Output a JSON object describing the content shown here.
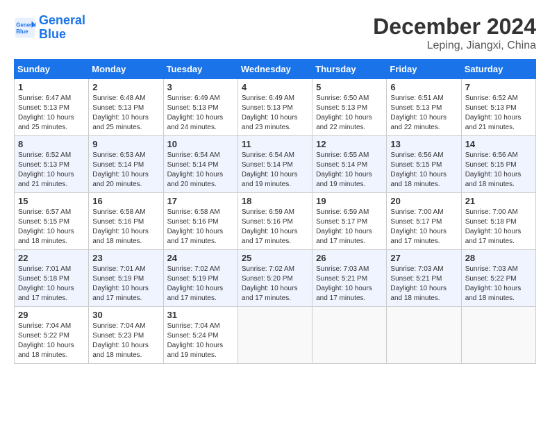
{
  "header": {
    "logo_line1": "General",
    "logo_line2": "Blue",
    "month_title": "December 2024",
    "location": "Leping, Jiangxi, China"
  },
  "days_of_week": [
    "Sunday",
    "Monday",
    "Tuesday",
    "Wednesday",
    "Thursday",
    "Friday",
    "Saturday"
  ],
  "weeks": [
    [
      {
        "day": "1",
        "sunrise": "6:47 AM",
        "sunset": "5:13 PM",
        "daylight": "10 hours and 25 minutes."
      },
      {
        "day": "2",
        "sunrise": "6:48 AM",
        "sunset": "5:13 PM",
        "daylight": "10 hours and 25 minutes."
      },
      {
        "day": "3",
        "sunrise": "6:49 AM",
        "sunset": "5:13 PM",
        "daylight": "10 hours and 24 minutes."
      },
      {
        "day": "4",
        "sunrise": "6:49 AM",
        "sunset": "5:13 PM",
        "daylight": "10 hours and 23 minutes."
      },
      {
        "day": "5",
        "sunrise": "6:50 AM",
        "sunset": "5:13 PM",
        "daylight": "10 hours and 22 minutes."
      },
      {
        "day": "6",
        "sunrise": "6:51 AM",
        "sunset": "5:13 PM",
        "daylight": "10 hours and 22 minutes."
      },
      {
        "day": "7",
        "sunrise": "6:52 AM",
        "sunset": "5:13 PM",
        "daylight": "10 hours and 21 minutes."
      }
    ],
    [
      {
        "day": "8",
        "sunrise": "6:52 AM",
        "sunset": "5:13 PM",
        "daylight": "10 hours and 21 minutes."
      },
      {
        "day": "9",
        "sunrise": "6:53 AM",
        "sunset": "5:14 PM",
        "daylight": "10 hours and 20 minutes."
      },
      {
        "day": "10",
        "sunrise": "6:54 AM",
        "sunset": "5:14 PM",
        "daylight": "10 hours and 20 minutes."
      },
      {
        "day": "11",
        "sunrise": "6:54 AM",
        "sunset": "5:14 PM",
        "daylight": "10 hours and 19 minutes."
      },
      {
        "day": "12",
        "sunrise": "6:55 AM",
        "sunset": "5:14 PM",
        "daylight": "10 hours and 19 minutes."
      },
      {
        "day": "13",
        "sunrise": "6:56 AM",
        "sunset": "5:15 PM",
        "daylight": "10 hours and 18 minutes."
      },
      {
        "day": "14",
        "sunrise": "6:56 AM",
        "sunset": "5:15 PM",
        "daylight": "10 hours and 18 minutes."
      }
    ],
    [
      {
        "day": "15",
        "sunrise": "6:57 AM",
        "sunset": "5:15 PM",
        "daylight": "10 hours and 18 minutes."
      },
      {
        "day": "16",
        "sunrise": "6:58 AM",
        "sunset": "5:16 PM",
        "daylight": "10 hours and 18 minutes."
      },
      {
        "day": "17",
        "sunrise": "6:58 AM",
        "sunset": "5:16 PM",
        "daylight": "10 hours and 17 minutes."
      },
      {
        "day": "18",
        "sunrise": "6:59 AM",
        "sunset": "5:16 PM",
        "daylight": "10 hours and 17 minutes."
      },
      {
        "day": "19",
        "sunrise": "6:59 AM",
        "sunset": "5:17 PM",
        "daylight": "10 hours and 17 minutes."
      },
      {
        "day": "20",
        "sunrise": "7:00 AM",
        "sunset": "5:17 PM",
        "daylight": "10 hours and 17 minutes."
      },
      {
        "day": "21",
        "sunrise": "7:00 AM",
        "sunset": "5:18 PM",
        "daylight": "10 hours and 17 minutes."
      }
    ],
    [
      {
        "day": "22",
        "sunrise": "7:01 AM",
        "sunset": "5:18 PM",
        "daylight": "10 hours and 17 minutes."
      },
      {
        "day": "23",
        "sunrise": "7:01 AM",
        "sunset": "5:19 PM",
        "daylight": "10 hours and 17 minutes."
      },
      {
        "day": "24",
        "sunrise": "7:02 AM",
        "sunset": "5:19 PM",
        "daylight": "10 hours and 17 minutes."
      },
      {
        "day": "25",
        "sunrise": "7:02 AM",
        "sunset": "5:20 PM",
        "daylight": "10 hours and 17 minutes."
      },
      {
        "day": "26",
        "sunrise": "7:03 AM",
        "sunset": "5:21 PM",
        "daylight": "10 hours and 17 minutes."
      },
      {
        "day": "27",
        "sunrise": "7:03 AM",
        "sunset": "5:21 PM",
        "daylight": "10 hours and 18 minutes."
      },
      {
        "day": "28",
        "sunrise": "7:03 AM",
        "sunset": "5:22 PM",
        "daylight": "10 hours and 18 minutes."
      }
    ],
    [
      {
        "day": "29",
        "sunrise": "7:04 AM",
        "sunset": "5:22 PM",
        "daylight": "10 hours and 18 minutes."
      },
      {
        "day": "30",
        "sunrise": "7:04 AM",
        "sunset": "5:23 PM",
        "daylight": "10 hours and 18 minutes."
      },
      {
        "day": "31",
        "sunrise": "7:04 AM",
        "sunset": "5:24 PM",
        "daylight": "10 hours and 19 minutes."
      },
      null,
      null,
      null,
      null
    ]
  ]
}
